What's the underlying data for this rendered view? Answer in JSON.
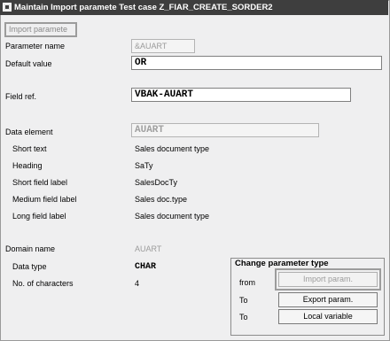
{
  "window": {
    "title": "Maintain Import paramete  Test case Z_FIAR_CREATE_SORDER2"
  },
  "tab": {
    "label": "Import paramete"
  },
  "fields": {
    "parameter_name": {
      "label": "Parameter name",
      "value": "&AUART"
    },
    "default_value": {
      "label": "Default value",
      "value": "OR"
    },
    "field_ref": {
      "label": "Field ref.",
      "value": "VBAK-AUART"
    },
    "data_element": {
      "label": "Data element",
      "value": "AUART"
    },
    "short_text": {
      "label": "Short text",
      "value": "Sales document type"
    },
    "heading": {
      "label": "Heading",
      "value": "SaTy"
    },
    "short_field_label": {
      "label": "Short field label",
      "value": "SalesDocTy"
    },
    "medium_field_label": {
      "label": "Medium field label",
      "value": "Sales doc.type"
    },
    "long_field_label": {
      "label": "Long field label",
      "value": "Sales document type"
    },
    "domain_name": {
      "label": "Domain name",
      "value": "AUART"
    },
    "data_type": {
      "label": "Data type",
      "value": "CHAR"
    },
    "no_of_characters": {
      "label": "No. of characters",
      "value": "4"
    }
  },
  "change_param": {
    "title": "Change parameter type",
    "rows": [
      {
        "label": "from",
        "button": "Import param."
      },
      {
        "label": "To",
        "button": "Export param."
      },
      {
        "label": "To",
        "button": "Local variable"
      }
    ]
  }
}
